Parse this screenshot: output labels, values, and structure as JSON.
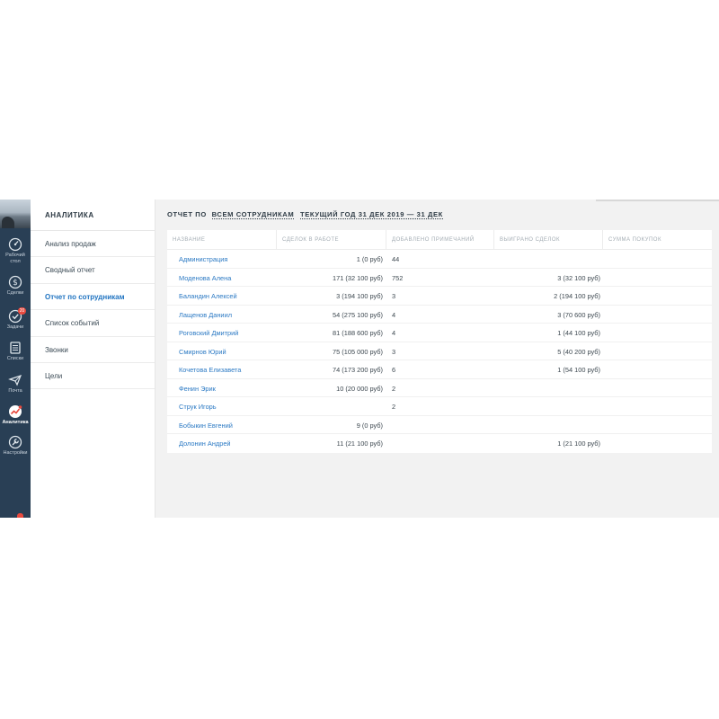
{
  "rail": {
    "items": [
      {
        "label_line1": "Рабочий",
        "label_line2": "стол",
        "icon": "dashboard-icon"
      },
      {
        "label": "Сделки",
        "icon": "dollar-icon"
      },
      {
        "label": "Задачи",
        "icon": "check-icon",
        "badge": "20"
      },
      {
        "label": "Списки",
        "icon": "list-icon"
      },
      {
        "label": "Почта",
        "icon": "mail-icon"
      },
      {
        "label": "Аналитика",
        "icon": "analytics-icon"
      },
      {
        "label": "Настройки",
        "icon": "wrench-icon"
      }
    ],
    "accent": "#e8493e"
  },
  "menu": {
    "title": "АНАЛИТИКА",
    "items": [
      {
        "label": "Анализ продаж"
      },
      {
        "label": "Сводный отчет"
      },
      {
        "label": "Отчет по сотрудникам"
      },
      {
        "label": "Список событий"
      },
      {
        "label": "Звонки"
      },
      {
        "label": "Цели"
      }
    ],
    "active_color": "#1f73c1"
  },
  "report": {
    "prefix": "ОТЧЕТ ПО",
    "scope": "ВСЕМ СОТРУДНИКАМ",
    "period": "ТЕКУЩИЙ ГОД 31 ДЕК 2019 — 31 ДЕК"
  },
  "table": {
    "columns": [
      "НАЗВАНИЕ",
      "СДЕЛОК В РАБОТЕ",
      "ДОБАВЛЕНО ПРИМЕЧАНИЙ",
      "ВЫИГРАНО СДЕЛОК",
      "СУММА ПОКУПОК"
    ],
    "rows": [
      {
        "name": "Администрация",
        "deals": "1 (0 руб)",
        "notes": "44",
        "won": "",
        "sum": ""
      },
      {
        "name": "Моденова Алена",
        "deals": "171 (32 100 руб)",
        "notes": "752",
        "won": "3 (32 100 руб)",
        "sum": ""
      },
      {
        "name": "Баландин Алексей",
        "deals": "3 (194 100 руб)",
        "notes": "3",
        "won": "2 (194 100 руб)",
        "sum": ""
      },
      {
        "name": "Лащенов Даниил",
        "deals": "54 (275 100 руб)",
        "notes": "4",
        "won": "3 (70 600 руб)",
        "sum": ""
      },
      {
        "name": "Роговский Дмитрий",
        "deals": "81 (188 600 руб)",
        "notes": "4",
        "won": "1 (44 100 руб)",
        "sum": ""
      },
      {
        "name": "Смирнов Юрий",
        "deals": "75 (105 000 руб)",
        "notes": "3",
        "won": "5 (40 200 руб)",
        "sum": ""
      },
      {
        "name": "Кочетова Елизавета",
        "deals": "74 (173 200 руб)",
        "notes": "6",
        "won": "1 (54 100 руб)",
        "sum": ""
      },
      {
        "name": "Фенин Эрик",
        "deals": "10 (20 000 руб)",
        "notes": "2",
        "won": "",
        "sum": ""
      },
      {
        "name": "Струк Игорь",
        "deals": "",
        "notes": "2",
        "won": "",
        "sum": ""
      },
      {
        "name": "Бобыкин Евгений",
        "deals": "9 (0 руб)",
        "notes": "",
        "won": "",
        "sum": ""
      },
      {
        "name": "Долонин Андрей",
        "deals": "11 (21 100 руб)",
        "notes": "",
        "won": "1 (21 100 руб)",
        "sum": ""
      }
    ],
    "link_color": "#2c7ac4"
  }
}
